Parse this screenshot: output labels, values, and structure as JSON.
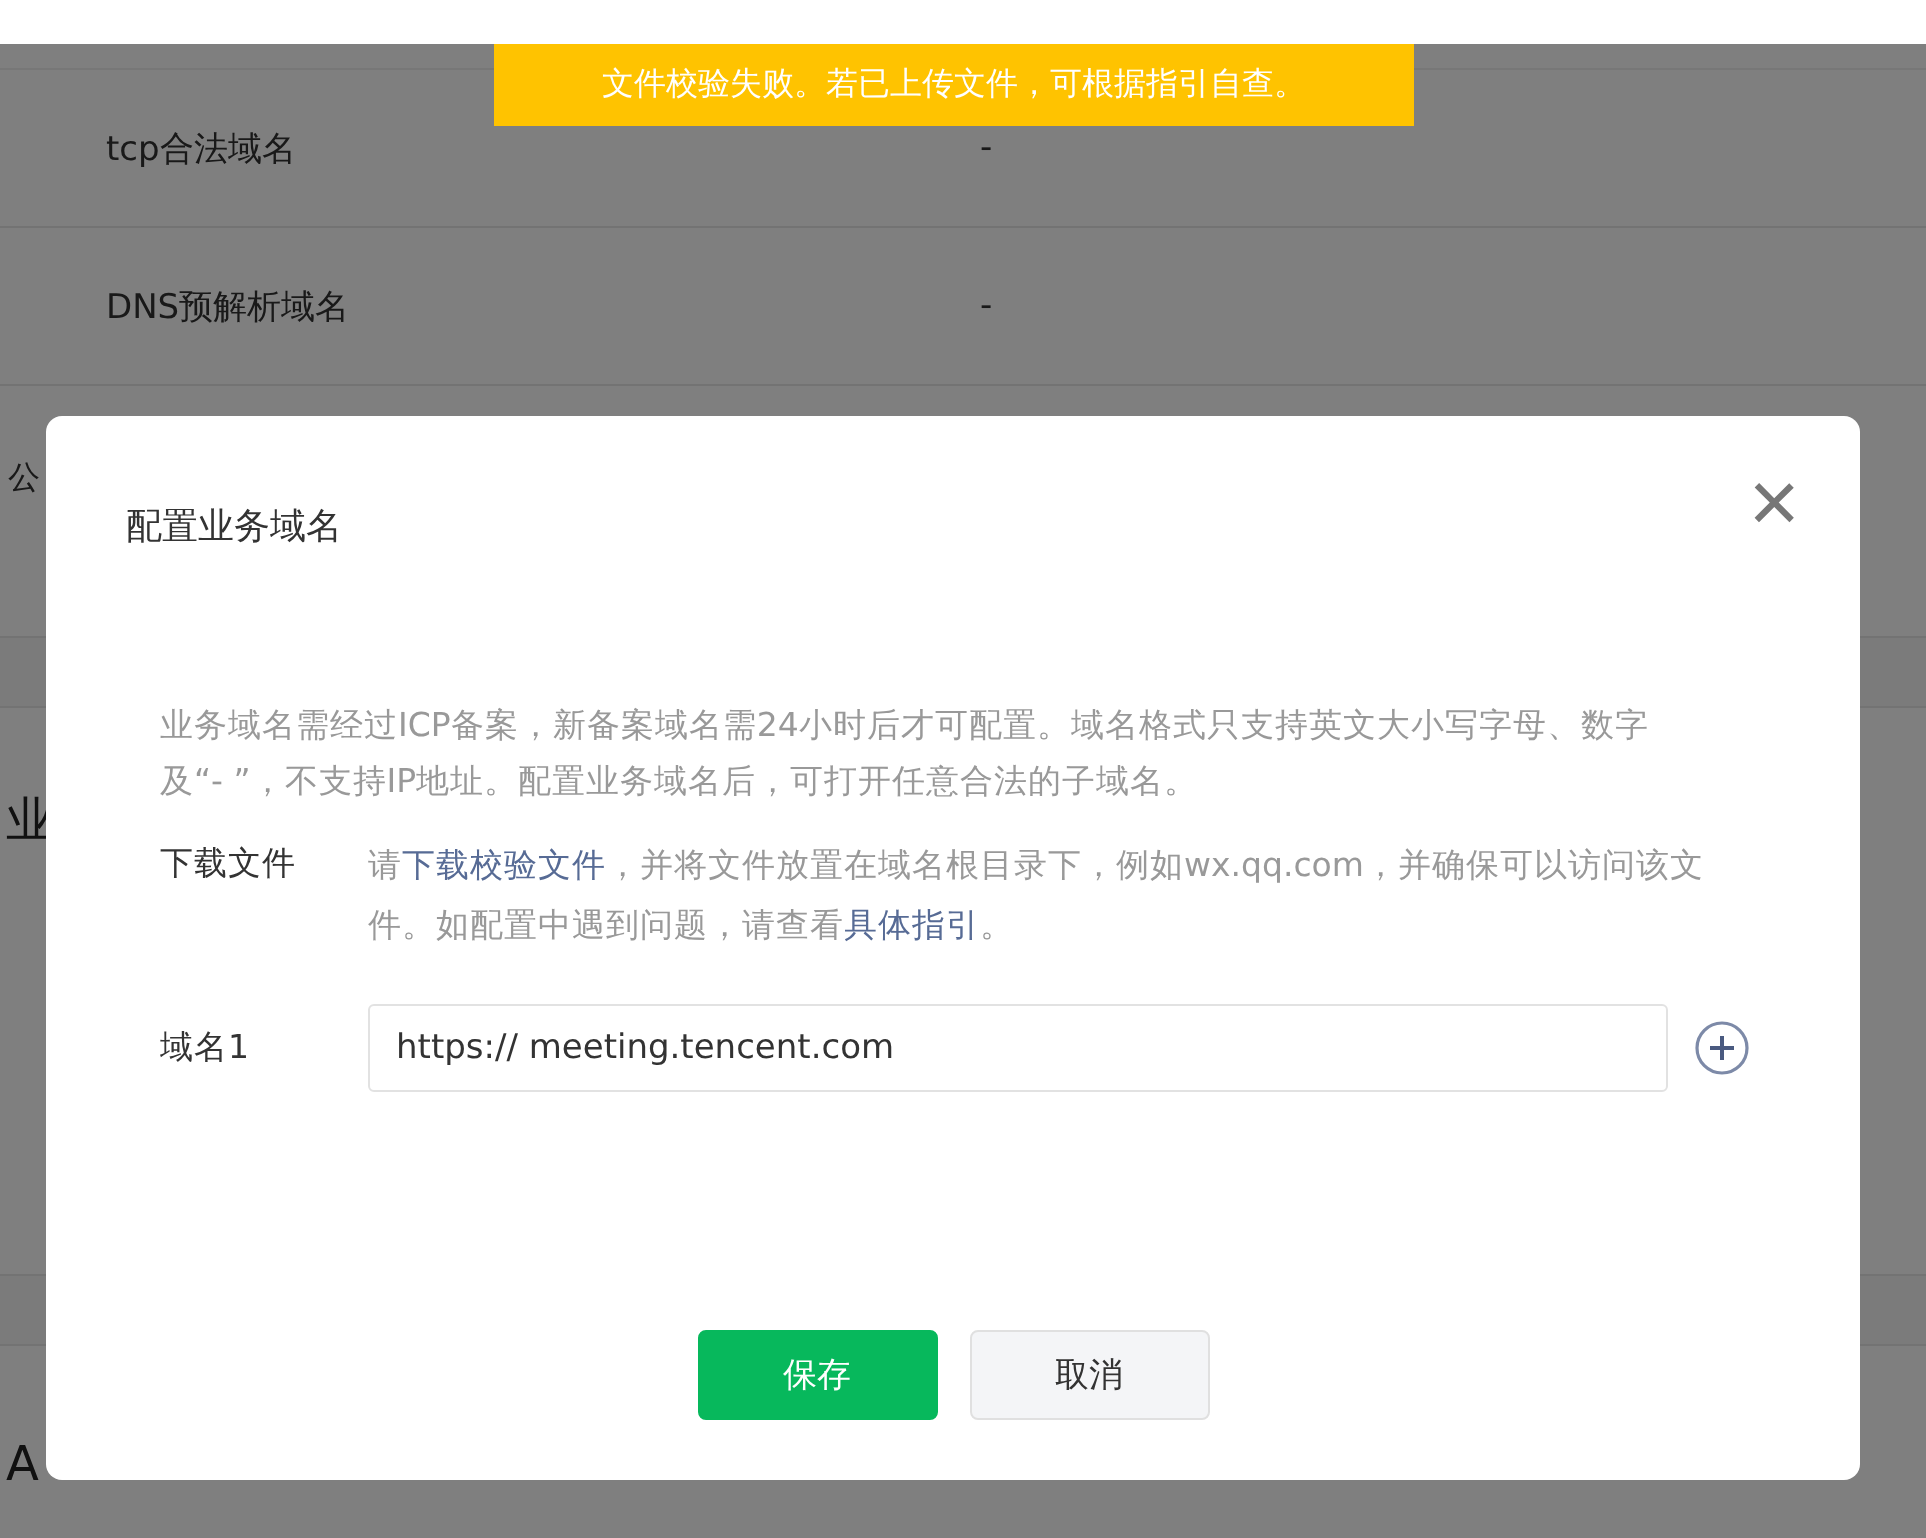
{
  "toast": {
    "text": "文件校验失败。若已上传文件，可根据指引自查。"
  },
  "background": {
    "rows": [
      {
        "label": "tcp合法域名",
        "value": "-"
      },
      {
        "label": "DNS预解析域名",
        "value": "-"
      }
    ],
    "fragments": [
      "公",
      "业",
      "A"
    ]
  },
  "dialog": {
    "title": "配置业务域名",
    "close": "×",
    "description": "业务域名需经过ICP备案，新备案域名需24小时后才可配置。域名格式只支持英文大小写字母、数字及“- ”，不支持IP地址。配置业务域名后，可打开任意合法的子域名。",
    "download": {
      "label": "下载文件",
      "parts": [
        {
          "kind": "text",
          "text": "请"
        },
        {
          "kind": "link",
          "text": "下载校验文件"
        },
        {
          "kind": "text",
          "text": "，并将文件放置在域名根目录下，例如wx.qq.com，并确保可以访问该文件。如配置中遇到问题，请查看"
        },
        {
          "kind": "link",
          "text": "具体指引"
        },
        {
          "kind": "text",
          "text": "。"
        }
      ]
    },
    "domains": [
      {
        "label": "域名1",
        "value": "https:// meeting.tencent.com"
      }
    ],
    "buttons": [
      {
        "label": "保存",
        "kind": "primary"
      },
      {
        "label": "取消",
        "kind": "secondary"
      }
    ]
  }
}
